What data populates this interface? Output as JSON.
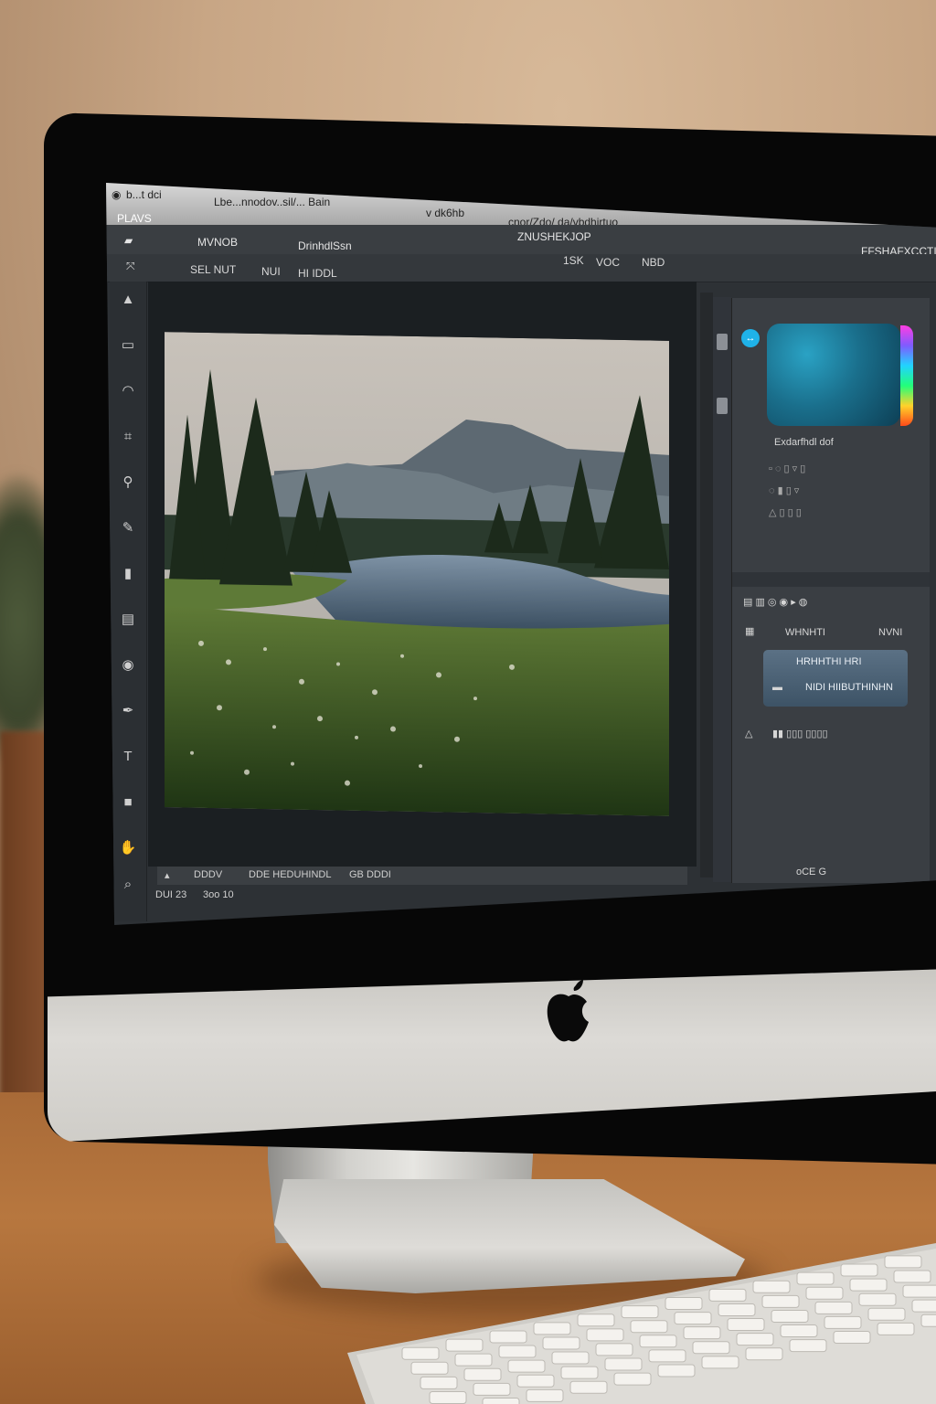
{
  "window": {
    "title_left": "b...t dci",
    "doc_title": "Lbe...nnodov..sil/... Bain",
    "mid": "v dk6hb",
    "path": "cnor/Zdo/ da/vbdhirtuo"
  },
  "menubar": {
    "app": "PLAVS",
    "items": [
      "MVNOB",
      "DrinhdlSsn",
      "ZNUSHEKJOP"
    ],
    "right": "FFSHAFXCCTI"
  },
  "optbar": {
    "items": [
      "SEL NUT",
      "NUI",
      "HI IDDL",
      "1SK",
      "VOC",
      "NBD"
    ]
  },
  "panel": {
    "color_label": "Exdarfhdl dof",
    "layers_title": "WHNHTI",
    "layers_mode": "NVNI",
    "layer_name": "HRHHTHI HRI",
    "layer_row2": "NIDI HIIBUTHINHN",
    "footer": "oCE G"
  },
  "status": {
    "zoom": "DDDV",
    "doc": "DDE HEDUHINDL",
    "extra": "GB DDDI"
  },
  "bottom": {
    "info": "DUI 23",
    "tool": "3oo 10"
  },
  "colors": {
    "accent": "#1fb2e8",
    "ui_dark": "#2d3135"
  },
  "icons": [
    "move-icon",
    "marquee-icon",
    "lasso-icon",
    "crop-icon",
    "brush-icon",
    "eraser-icon",
    "text-icon",
    "zoom-icon",
    "apple-logo"
  ]
}
